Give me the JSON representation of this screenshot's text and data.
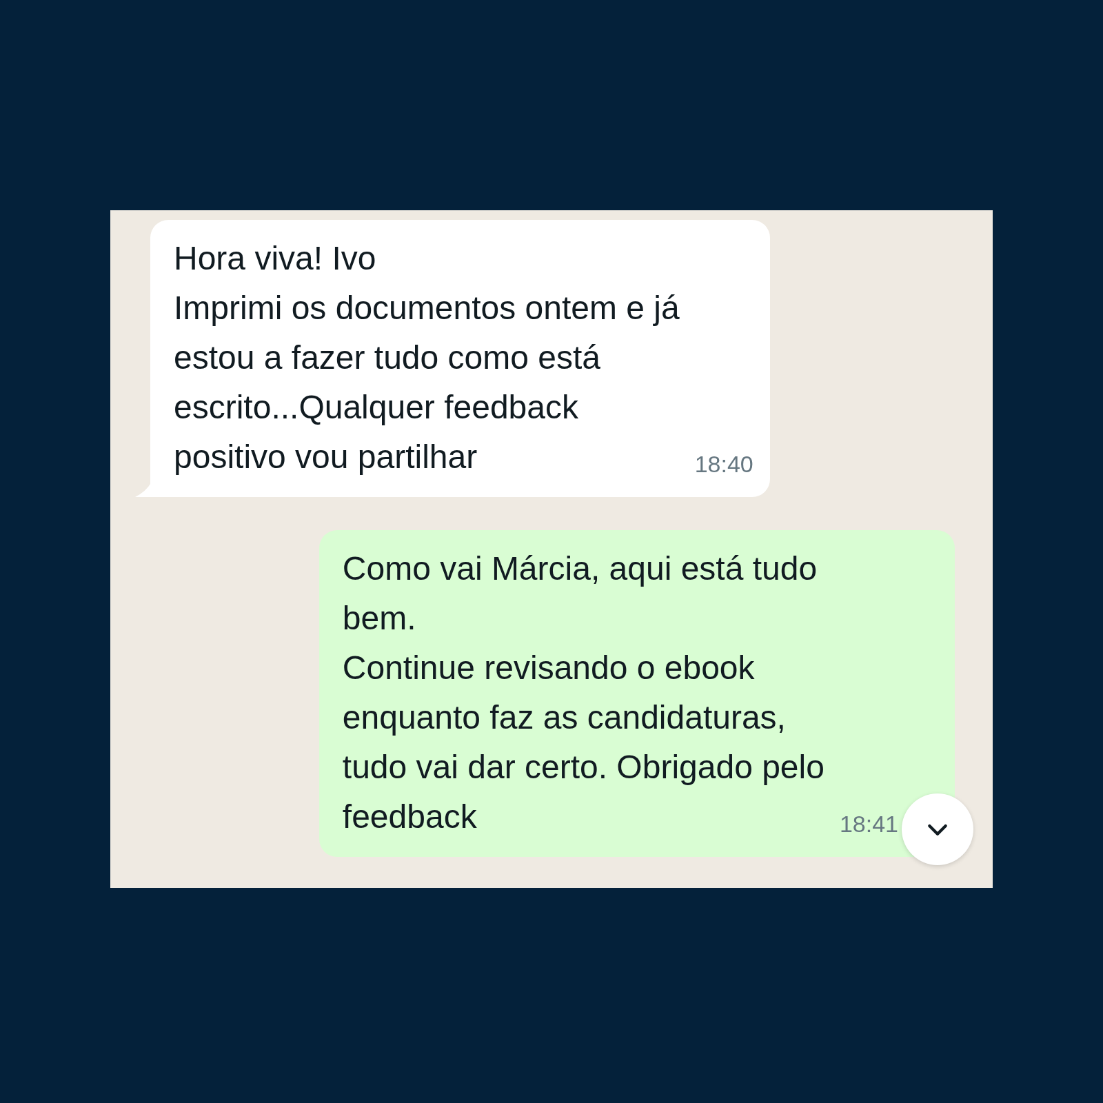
{
  "messages": [
    {
      "kind": "incoming",
      "text": "Hora viva! Ivo\nImprimi os documentos ontem e já\nestou a fazer tudo como está\nescrito...Qualquer feedback\npositivo vou partilhar",
      "time": "18:40"
    },
    {
      "kind": "outgoing",
      "text": "Como vai Márcia, aqui está tudo\nbem.\nContinue revisando o ebook\nenquanto faz as candidaturas,\ntudo vai dar certo. Obrigado pelo\nfeedback",
      "time": "18:41"
    }
  ]
}
